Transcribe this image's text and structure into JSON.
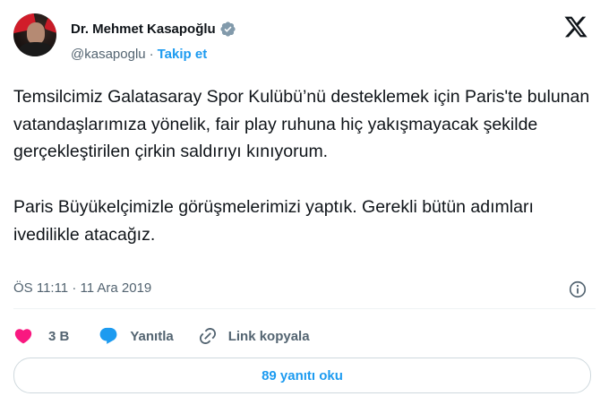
{
  "author": {
    "name": "Dr. Mehmet Kasapoğlu",
    "handle": "@kasapoglu",
    "separator": "·",
    "follow_label": "Takip et"
  },
  "tweet": {
    "text": "Temsilcimiz Galatasaray Spor Kulübü’nü desteklemek için Paris'te bulunan vatandaşlarımıza yönelik, fair play ruhuna hiç yakışmayacak şekilde gerçekleştirilen çirkin saldırıyı kınıyorum.\n\nParis Büyükelçimizle görüşmelerimizi yaptık. Gerekli bütün adımları ivedilikle atacağız.",
    "timestamp": "ÖS 11:11 · 11 Ara 2019"
  },
  "actions": {
    "like_count": "3 B",
    "reply_label": "Yanıtla",
    "copy_link_label": "Link kopyala"
  },
  "read_replies_label": "89 yanıtı oku",
  "colors": {
    "accent": "#1d9bf0",
    "like": "#f91880",
    "text": "#0f1419",
    "secondary": "#536471"
  },
  "icons": [
    "verified-badge-icon",
    "x-logo-icon",
    "info-icon",
    "heart-icon",
    "reply-bubble-icon",
    "link-icon"
  ]
}
